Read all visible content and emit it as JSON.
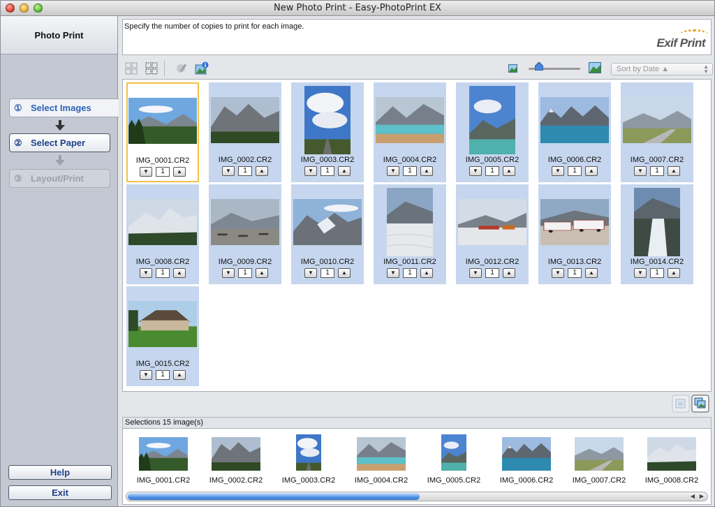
{
  "window": {
    "title": "New Photo Print - Easy-PhotoPrint EX"
  },
  "sidebar": {
    "header": "Photo Print",
    "steps": [
      {
        "num": "①",
        "label": "Select Images",
        "state": "active"
      },
      {
        "num": "②",
        "label": "Select Paper",
        "state": "enabled"
      },
      {
        "num": "③",
        "label": "Layout/Print",
        "state": "disabled"
      }
    ],
    "help_label": "Help",
    "exit_label": "Exit"
  },
  "instruction": "Specify the number of copies to print for each image.",
  "brand": {
    "logo_text": "Exif Print"
  },
  "toolbar": {
    "icons": [
      "select-all-icon",
      "deselect-all-icon",
      "edit-icon",
      "image-info-icon"
    ],
    "zoom_min_icon": "small-image-icon",
    "zoom_max_icon": "large-image-icon",
    "zoom_level": 0.2,
    "sort_label": "Sort by Date ▲"
  },
  "images": [
    {
      "name": "IMG_0001.CR2",
      "count": "1",
      "orient": "landscape",
      "scene": "mountain-forest",
      "selected": true
    },
    {
      "name": "IMG_0002.CR2",
      "count": "1",
      "orient": "landscape",
      "scene": "mountain-grey"
    },
    {
      "name": "IMG_0003.CR2",
      "count": "1",
      "orient": "portrait",
      "scene": "clouds-road"
    },
    {
      "name": "IMG_0004.CR2",
      "count": "1",
      "orient": "landscape",
      "scene": "lake-teal"
    },
    {
      "name": "IMG_0005.CR2",
      "count": "1",
      "orient": "portrait",
      "scene": "lake-sky"
    },
    {
      "name": "IMG_0006.CR2",
      "count": "1",
      "orient": "landscape",
      "scene": "lake-blue"
    },
    {
      "name": "IMG_0007.CR2",
      "count": "1",
      "orient": "landscape",
      "scene": "valley-road"
    },
    {
      "name": "IMG_0008.CR2",
      "count": "1",
      "orient": "landscape",
      "scene": "snow-mountain"
    },
    {
      "name": "IMG_0009.CR2",
      "count": "1",
      "orient": "landscape",
      "scene": "picnic"
    },
    {
      "name": "IMG_0010.CR2",
      "count": "1",
      "orient": "landscape",
      "scene": "glacier"
    },
    {
      "name": "IMG_0011.CR2",
      "count": "1",
      "orient": "portrait",
      "scene": "icefield"
    },
    {
      "name": "IMG_0012.CR2",
      "count": "1",
      "orient": "landscape",
      "scene": "icefield-people"
    },
    {
      "name": "IMG_0013.CR2",
      "count": "1",
      "orient": "landscape",
      "scene": "snowcoach"
    },
    {
      "name": "IMG_0014.CR2",
      "count": "1",
      "orient": "portrait",
      "scene": "waterfall"
    },
    {
      "name": "IMG_0015.CR2",
      "count": "1",
      "orient": "landscape",
      "scene": "house"
    }
  ],
  "selections": {
    "label": "Selections 15 image(s)",
    "items": [
      {
        "name": "IMG_0001.CR2",
        "orient": "landscape",
        "scene": "mountain-forest"
      },
      {
        "name": "IMG_0002.CR2",
        "orient": "landscape",
        "scene": "mountain-grey"
      },
      {
        "name": "IMG_0003.CR2",
        "orient": "portrait",
        "scene": "clouds-road"
      },
      {
        "name": "IMG_0004.CR2",
        "orient": "landscape",
        "scene": "lake-teal"
      },
      {
        "name": "IMG_0005.CR2",
        "orient": "portrait",
        "scene": "lake-sky"
      },
      {
        "name": "IMG_0006.CR2",
        "orient": "landscape",
        "scene": "lake-blue"
      },
      {
        "name": "IMG_0007.CR2",
        "orient": "landscape",
        "scene": "valley-road"
      },
      {
        "name": "IMG_0008.CR2",
        "orient": "landscape",
        "scene": "snow-mountain"
      }
    ],
    "scroll_position": 0.0,
    "scroll_visible_fraction": 0.52
  },
  "colors": {
    "accent": "#2e62b5",
    "card_bg": "#c6d6ee",
    "selection_border": "#f2c244"
  }
}
